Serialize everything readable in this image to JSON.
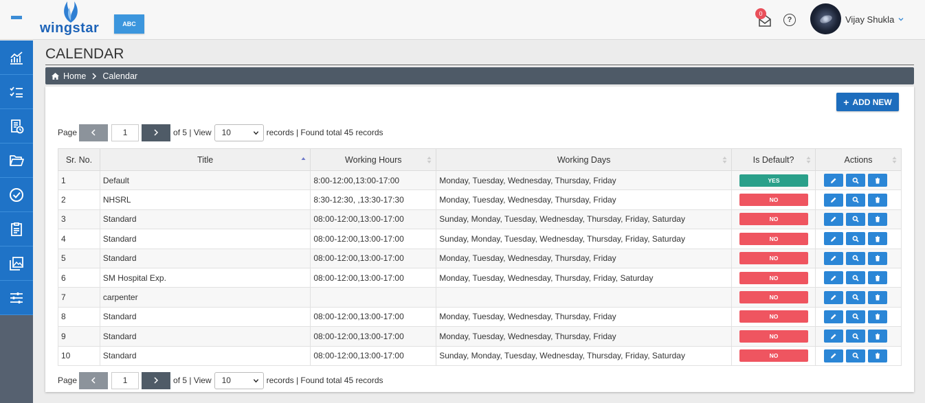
{
  "header": {
    "logo_text": "wingstar",
    "company_button": "ABC",
    "notifications_count": "0",
    "help_symbol": "?",
    "user_name": "Vijay Shukla"
  },
  "sidebar": {
    "items": [
      {
        "icon": "analytics-icon"
      },
      {
        "icon": "checklist-icon"
      },
      {
        "icon": "timesheet-icon"
      },
      {
        "icon": "folder-icon"
      },
      {
        "icon": "check-circle-icon"
      },
      {
        "icon": "clipboard-icon"
      },
      {
        "icon": "gallery-icon"
      },
      {
        "icon": "settings-sliders-icon"
      }
    ]
  },
  "page": {
    "title": "CALENDAR",
    "breadcrumb_home": "Home",
    "breadcrumb_current": "Calendar",
    "add_new_label": "ADD NEW"
  },
  "pager": {
    "page_label": "Page",
    "current_page": "1",
    "of_pages": "of 5 | View",
    "view_value": "10",
    "records_text": "records | Found total 45 records"
  },
  "table": {
    "headers": {
      "sr": "Sr. No.",
      "title": "Title",
      "hours": "Working Hours",
      "days": "Working Days",
      "default": "Is Default?",
      "actions": "Actions"
    },
    "rows": [
      {
        "sr": "1",
        "title": "Default",
        "hours": "8:00-12:00,13:00-17:00",
        "days": "Monday, Tuesday, Wednesday, Thursday, Friday",
        "default": "YES"
      },
      {
        "sr": "2",
        "title": "NHSRL",
        "hours": "8:30-12:30, ,13:30-17:30",
        "days": "Monday, Tuesday, Wednesday, Thursday, Friday",
        "default": "NO"
      },
      {
        "sr": "3",
        "title": "Standard",
        "hours": "08:00-12:00,13:00-17:00",
        "days": "Sunday, Monday, Tuesday, Wednesday, Thursday, Friday, Saturday",
        "default": "NO"
      },
      {
        "sr": "4",
        "title": "Standard",
        "hours": "08:00-12:00,13:00-17:00",
        "days": "Sunday, Monday, Tuesday, Wednesday, Thursday, Friday, Saturday",
        "default": "NO"
      },
      {
        "sr": "5",
        "title": "Standard",
        "hours": "08:00-12:00,13:00-17:00",
        "days": "Monday, Tuesday, Wednesday, Thursday, Friday",
        "default": "NO"
      },
      {
        "sr": "6",
        "title": "SM Hospital Exp.",
        "hours": "08:00-12:00,13:00-17:00",
        "days": "Monday, Tuesday, Wednesday, Thursday, Friday, Saturday",
        "default": "NO"
      },
      {
        "sr": "7",
        "title": "carpenter",
        "hours": "",
        "days": "",
        "default": "NO"
      },
      {
        "sr": "8",
        "title": "Standard",
        "hours": "08:00-12:00,13:00-17:00",
        "days": "Monday, Tuesday, Wednesday, Thursday, Friday",
        "default": "NO"
      },
      {
        "sr": "9",
        "title": "Standard",
        "hours": "08:00-12:00,13:00-17:00",
        "days": "Monday, Tuesday, Wednesday, Thursday, Friday",
        "default": "NO"
      },
      {
        "sr": "10",
        "title": "Standard",
        "hours": "08:00-12:00,13:00-17:00",
        "days": "Sunday, Monday, Tuesday, Wednesday, Thursday, Friday, Saturday",
        "default": "NO"
      }
    ]
  },
  "colors": {
    "primary": "#1f73c7",
    "yes": "#2aa08a",
    "no": "#ef5560",
    "breadcrumb_bg": "#4e5a67"
  }
}
